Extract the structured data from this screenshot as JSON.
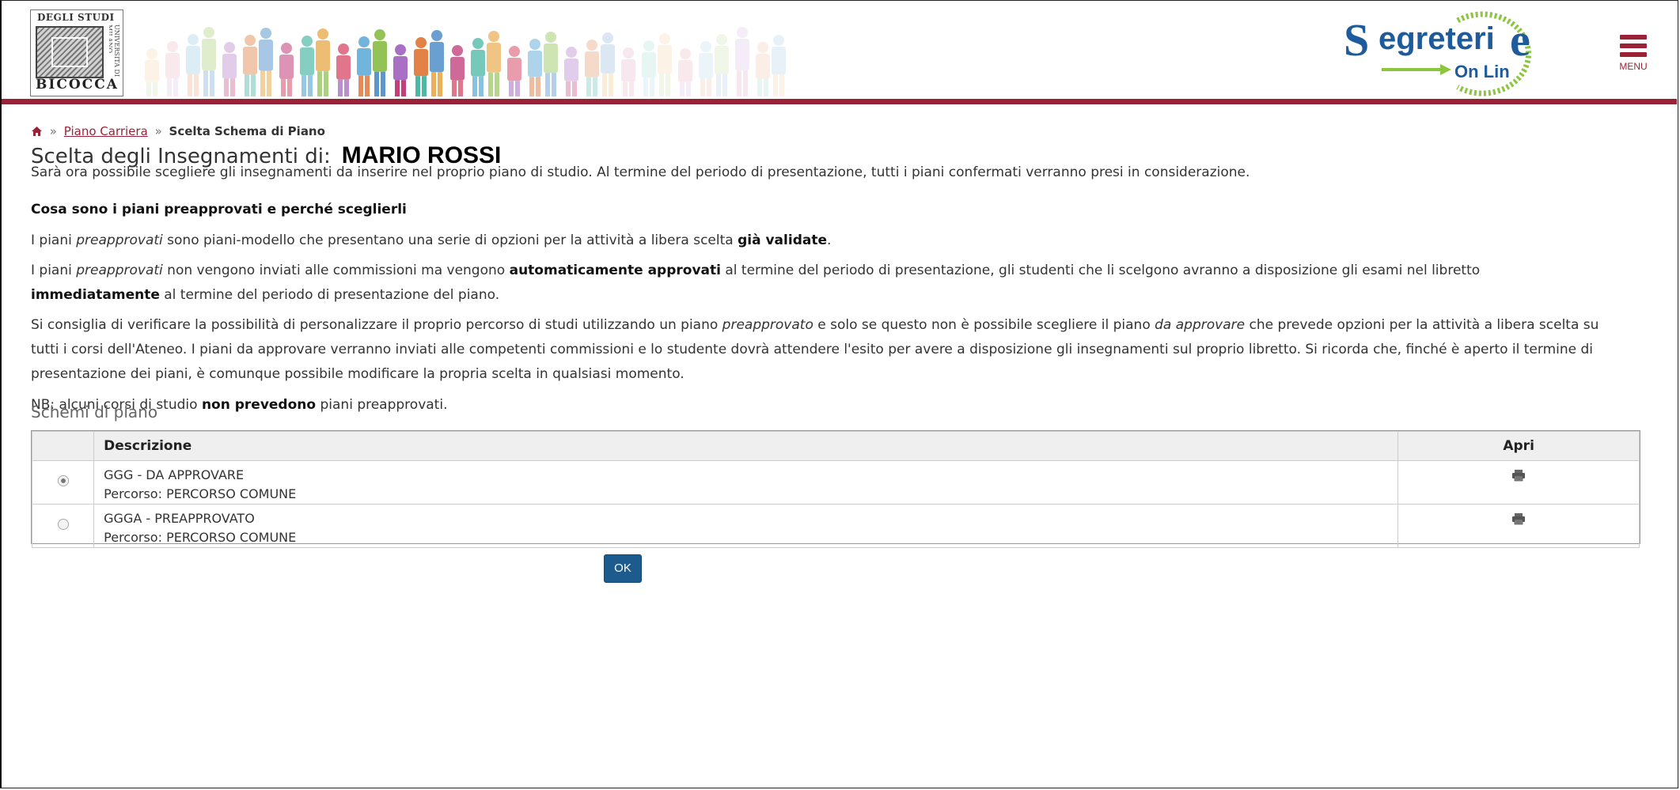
{
  "header": {
    "university_logo": {
      "top_text": "DEGLI STUDI",
      "side_text": "UNIVERSITÀ DI MILANO",
      "bottom_text": "BICOCCA"
    },
    "segreterie_logo": {
      "main_text": "egreteri",
      "sub_text": "On Lin"
    },
    "menu_label": "MENU",
    "accent_color": "#9b2236"
  },
  "breadcrumb": {
    "home_icon": "home-icon",
    "separator": "»",
    "link": "Piano Carriera",
    "current": "Scelta Schema di Piano"
  },
  "page": {
    "title": "Scelta degli Insegnamenti di:",
    "student_name": "MARIO ROSSI",
    "intro": "Sarà ora possibile scegliere gli insegnamenti da inserire nel proprio piano di studio. Al termine del periodo di presentazione, tutti i piani confermati verranno presi in considerazione.",
    "section_heading": "Cosa sono i piani preapprovati e perché sceglierli",
    "p1": {
      "a": "I piani ",
      "b_em": "preapprovati",
      "c": " sono piani-modello che presentano una serie di opzioni per la attività a libera scelta ",
      "d_bold": "già validate",
      "e": "."
    },
    "p2": {
      "a": "I piani ",
      "b_em": "preapprovati",
      "c": " non vengono inviati alle commissioni ma vengono ",
      "d_bold": "automaticamente approvati",
      "e": " al termine del periodo di presentazione, gli studenti che li scelgono avranno a disposizione gli esami nel libretto ",
      "f_bold": "immediatamente",
      "g": " al termine del periodo di presentazione del piano."
    },
    "p3": {
      "a": "Si consiglia di verificare la possibilità di personalizzare il proprio percorso di studi utilizzando un piano ",
      "b_em": "preapprovato",
      "c": " e solo se questo non è possibile scegliere il piano ",
      "d_em": "da approvare",
      "e": " che prevede opzioni per la attività a libera scelta su tutti i corsi dell'Ateneo. I piani da approvare verranno inviati alle competenti commissioni e lo studente dovrà attendere l'esito per avere a disposizione gli insegnamenti sul proprio libretto. Si ricorda che, finché è aperto il termine di presentazione dei piani, è comunque possibile modificare la propria scelta in qualsiasi momento."
    },
    "p4": {
      "a": "NB: alcuni corsi di studio ",
      "b_bold": "non prevedono",
      "c": " piani preapprovati."
    }
  },
  "schemi": {
    "title": "Schemi di piano",
    "columns": {
      "descrizione": "Descrizione",
      "apri": "Apri"
    },
    "rows": [
      {
        "selected": true,
        "name": "GGG - DA APPROVARE",
        "percorso": "Percorso: PERCORSO COMUNE",
        "action_icon": "printer-icon"
      },
      {
        "selected": false,
        "name": "GGGA - PREAPPROVATO",
        "percorso": "Percorso: PERCORSO COMUNE",
        "action_icon": "printer-icon"
      }
    ]
  },
  "ok_button": "OK"
}
